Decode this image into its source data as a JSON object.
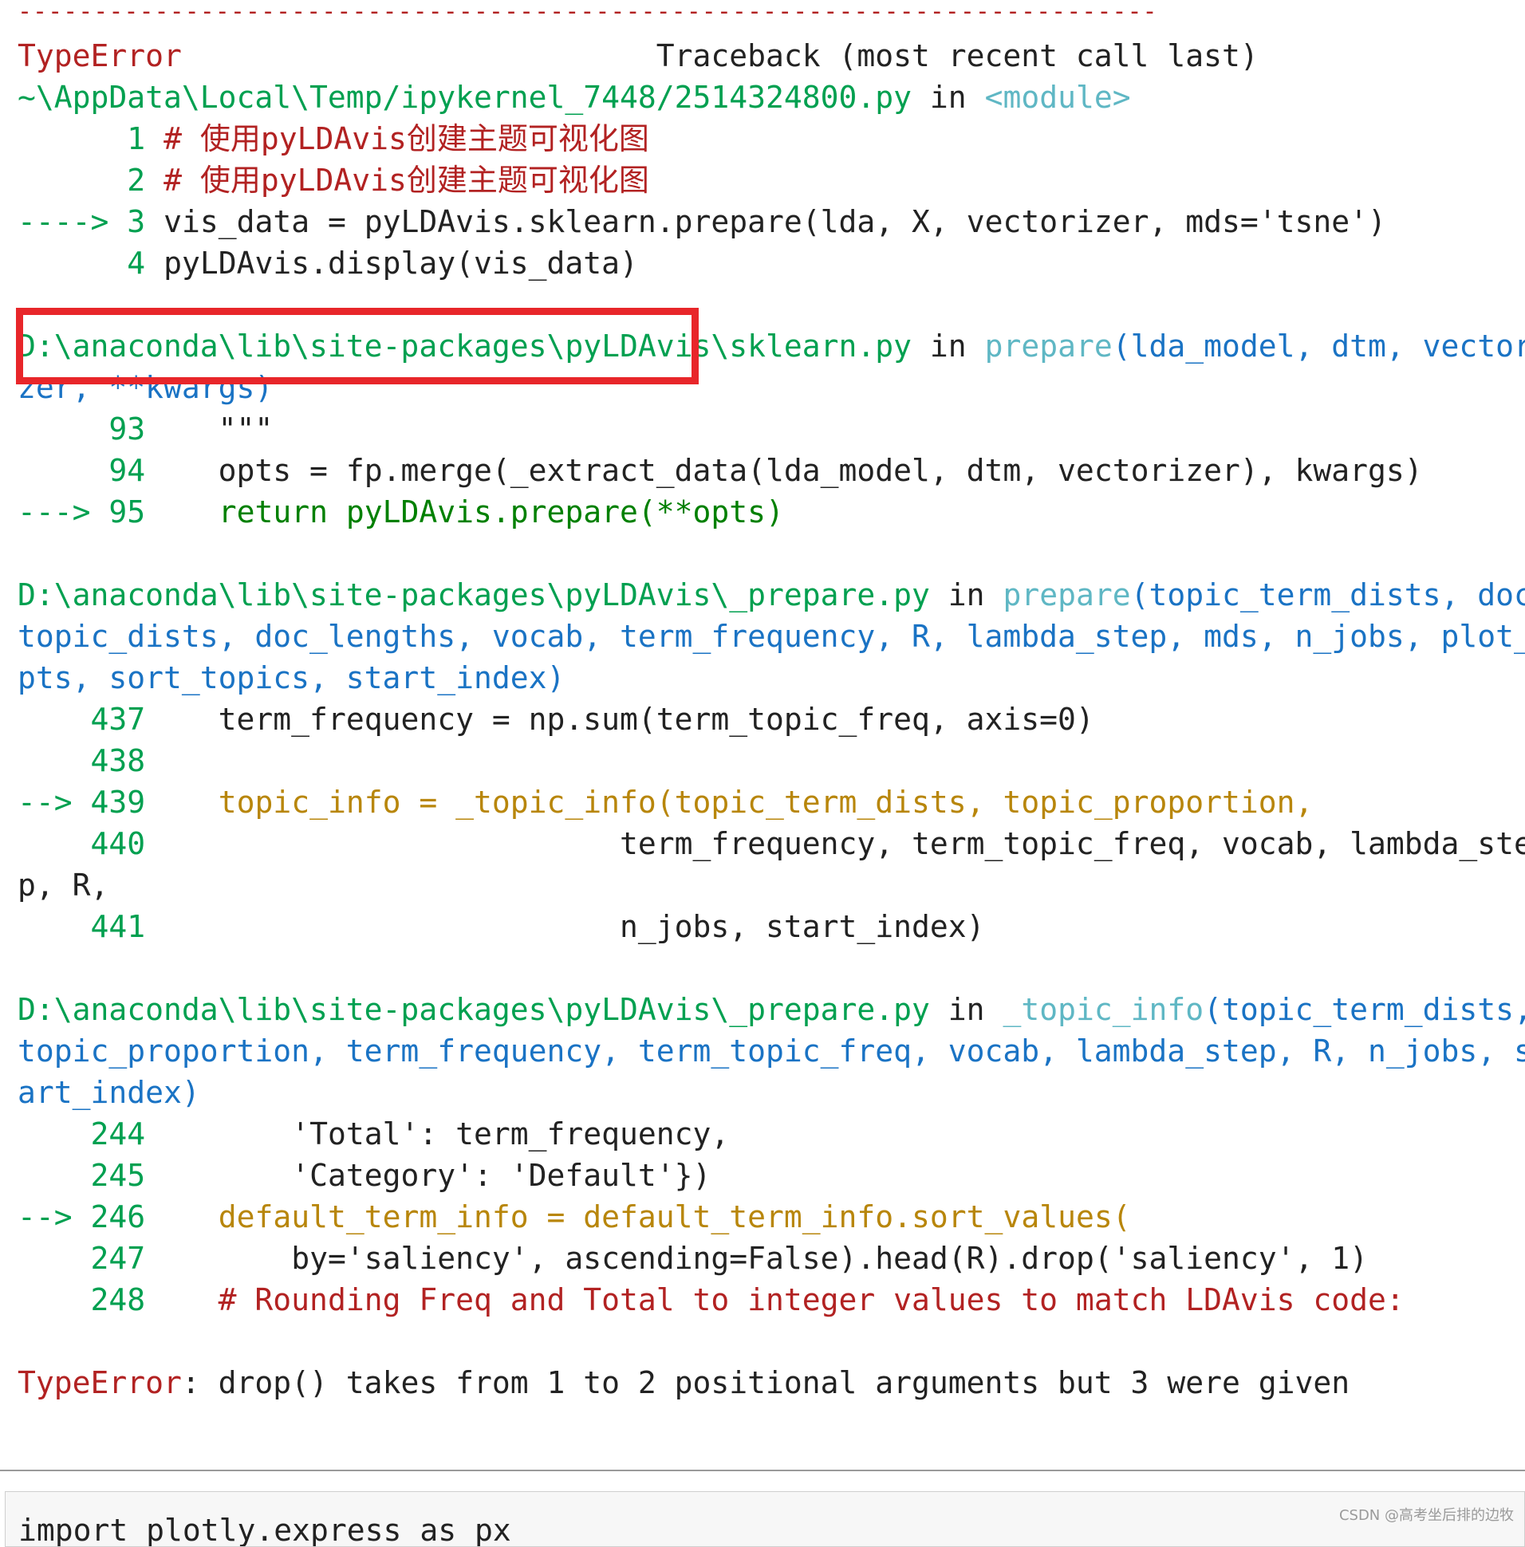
{
  "traceback": {
    "separator": "---------------------------------------------------------------------------",
    "header": {
      "error_name": "TypeError",
      "title": "Traceback (most recent call last)"
    },
    "frames": [
      {
        "path": "~\\AppData\\Local\\Temp/ipykernel_7448/2514324800.py",
        "in_word": "in",
        "function": "<module>",
        "args": "",
        "lines": [
          {
            "arrow": "",
            "num": "1",
            "code": "# 使用pyLDAvis创建主题可视化图"
          },
          {
            "arrow": "",
            "num": "2",
            "code": "# 使用pyLDAvis创建主题可视化图"
          },
          {
            "arrow": "---->",
            "num": "3",
            "code": "vis_data = pyLDAvis.sklearn.prepare(lda, X, vectorizer, mds='tsne')"
          },
          {
            "arrow": "",
            "num": "4",
            "code": "pyLDAvis.display(vis_data)"
          }
        ]
      },
      {
        "path": "D:\\anaconda\\lib\\site-packages\\pyLDAvis\\sklearn.py",
        "in_word": "in",
        "function": "prepare",
        "args_line1": "(lda_model, dtm, vectori",
        "args_line2": "zer, **kwargs)",
        "lines": [
          {
            "arrow": "",
            "num": "93",
            "code": "\"\"\""
          },
          {
            "arrow": "",
            "num": "94",
            "code": "opts = fp.merge(_extract_data(lda_model, dtm, vectorizer), kwargs)"
          },
          {
            "arrow": "--->",
            "num": "95",
            "code": "return pyLDAvis.prepare(**opts)"
          }
        ]
      },
      {
        "path": "D:\\anaconda\\lib\\site-packages\\pyLDAvis\\_prepare.py",
        "in_word": "in",
        "function": "prepare",
        "args_line1": "(topic_term_dists, doc_",
        "args_line2": "topic_dists, doc_lengths, vocab, term_frequency, R, lambda_step, mds, n_jobs, plot_o",
        "args_line3": "pts, sort_topics, start_index)",
        "lines": [
          {
            "arrow": "",
            "num": "437",
            "code": "term_frequency = np.sum(term_topic_freq, axis=0)"
          },
          {
            "arrow": "",
            "num": "438",
            "code": ""
          },
          {
            "arrow": "-->",
            "num": "439",
            "code": "topic_info = _topic_info(topic_term_dists, topic_proportion,"
          },
          {
            "arrow": "",
            "num": "440",
            "code": "term_frequency, term_topic_freq, vocab, lambda_ste"
          },
          {
            "arrow": "",
            "num": "",
            "code": "p, R,"
          },
          {
            "arrow": "",
            "num": "441",
            "code": "n_jobs, start_index)"
          }
        ]
      },
      {
        "path": "D:\\anaconda\\lib\\site-packages\\pyLDAvis\\_prepare.py",
        "in_word": "in",
        "function": "_topic_info",
        "args_line1": "(topic_term_dists,",
        "args_line2": "topic_proportion, term_frequency, term_topic_freq, vocab, lambda_step, R, n_jobs, st",
        "args_line3": "art_index)",
        "lines": [
          {
            "arrow": "",
            "num": "244",
            "code": "'Total': term_frequency,"
          },
          {
            "arrow": "",
            "num": "245",
            "code": "'Category': 'Default'})"
          },
          {
            "arrow": "-->",
            "num": "246",
            "code": "default_term_info = default_term_info.sort_values("
          },
          {
            "arrow": "",
            "num": "247",
            "code": "by='saliency', ascending=False).head(R).drop('saliency', 1)"
          },
          {
            "arrow": "",
            "num": "248",
            "code": "# Rounding Freq and Total to integer values to match LDAvis code:"
          }
        ]
      }
    ],
    "final_error": {
      "name": "TypeError",
      "message": ": drop() takes from 1 to 2 positional arguments but 3 were given"
    }
  },
  "next_cell": {
    "code": "import plotly.express as px"
  },
  "watermark": "CSDN @高考坐后排的边牧",
  "colors": {
    "error_red": "#b22222",
    "line_number_green": "#00a050",
    "function_cyan": "#5fb7c4",
    "args_blue": "#1a73c4",
    "highlight_line_gold": "#b8860b",
    "annotation_box_red": "#e8262a"
  }
}
